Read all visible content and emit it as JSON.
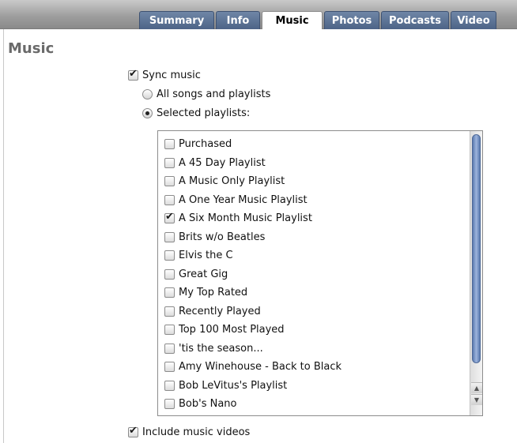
{
  "tabs": [
    {
      "label": "Summary",
      "active": false
    },
    {
      "label": "Info",
      "active": false
    },
    {
      "label": "Music",
      "active": true
    },
    {
      "label": "Photos",
      "active": false
    },
    {
      "label": "Podcasts",
      "active": false
    },
    {
      "label": "Video",
      "active": false
    }
  ],
  "section_title": "Music",
  "sync_music": {
    "label": "Sync music",
    "checked": true
  },
  "options": {
    "all_songs": {
      "label": "All songs and playlists",
      "selected": false
    },
    "selected_playlists": {
      "label": "Selected playlists:",
      "selected": true
    }
  },
  "playlists": [
    {
      "label": "Purchased",
      "checked": false
    },
    {
      "label": "A 45 Day Playlist",
      "checked": false
    },
    {
      "label": "A Music Only Playlist",
      "checked": false
    },
    {
      "label": "A One Year Music Playlist",
      "checked": false
    },
    {
      "label": "A Six Month Music Playlist",
      "checked": true
    },
    {
      "label": "Brits w/o Beatles",
      "checked": false
    },
    {
      "label": "Elvis the C",
      "checked": false
    },
    {
      "label": "Great Gig",
      "checked": false
    },
    {
      "label": "My Top Rated",
      "checked": false
    },
    {
      "label": "Recently Played",
      "checked": false
    },
    {
      "label": "Top 100 Most Played",
      "checked": false
    },
    {
      "label": "'tis the season...",
      "checked": false
    },
    {
      "label": "Amy Winehouse - Back to Black",
      "checked": false
    },
    {
      "label": "Bob LeVitus's Playlist",
      "checked": false
    },
    {
      "label": "Bob's Nano",
      "checked": false
    }
  ],
  "include_videos": {
    "label": "Include music videos",
    "checked": true
  },
  "scroll": {
    "up_icon": "triangle-up-icon",
    "down_icon": "triangle-down-icon"
  }
}
